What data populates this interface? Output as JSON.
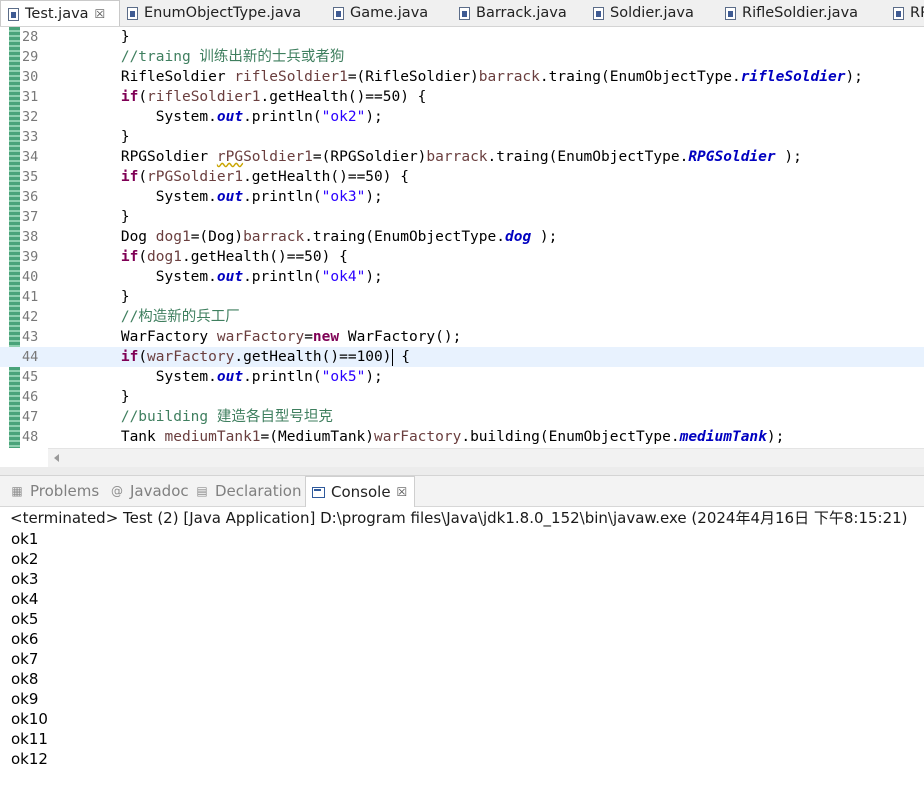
{
  "editor_tabs": [
    {
      "label": "Test.java",
      "active": true,
      "close": "☒"
    },
    {
      "label": "EnumObjectType.java"
    },
    {
      "label": "Game.java"
    },
    {
      "label": "Barrack.java"
    },
    {
      "label": "Soldier.java"
    },
    {
      "label": "RifleSoldier.java"
    },
    {
      "label": "RP"
    }
  ],
  "code": {
    "line_numbers": [
      "28",
      "29",
      "30",
      "31",
      "32",
      "33",
      "34",
      "35",
      "36",
      "37",
      "38",
      "39",
      "40",
      "41",
      "42",
      "43",
      "44",
      "45",
      "46",
      "47",
      "48"
    ],
    "current_line": "44"
  },
  "view_tabs": {
    "problems": "Problems",
    "javadoc": "Javadoc",
    "declaration": "Declaration",
    "console": "Console",
    "console_close": "☒"
  },
  "console": {
    "header": "<terminated> Test (2) [Java Application] D:\\program files\\Java\\jdk1.8.0_152\\bin\\javaw.exe (2024年4月16日 下午8:15:21)",
    "output": [
      "ok1",
      "ok2",
      "ok3",
      "ok4",
      "ok5",
      "ok6",
      "ok7",
      "ok8",
      "ok9",
      "ok10",
      "ok11",
      "ok12"
    ]
  }
}
